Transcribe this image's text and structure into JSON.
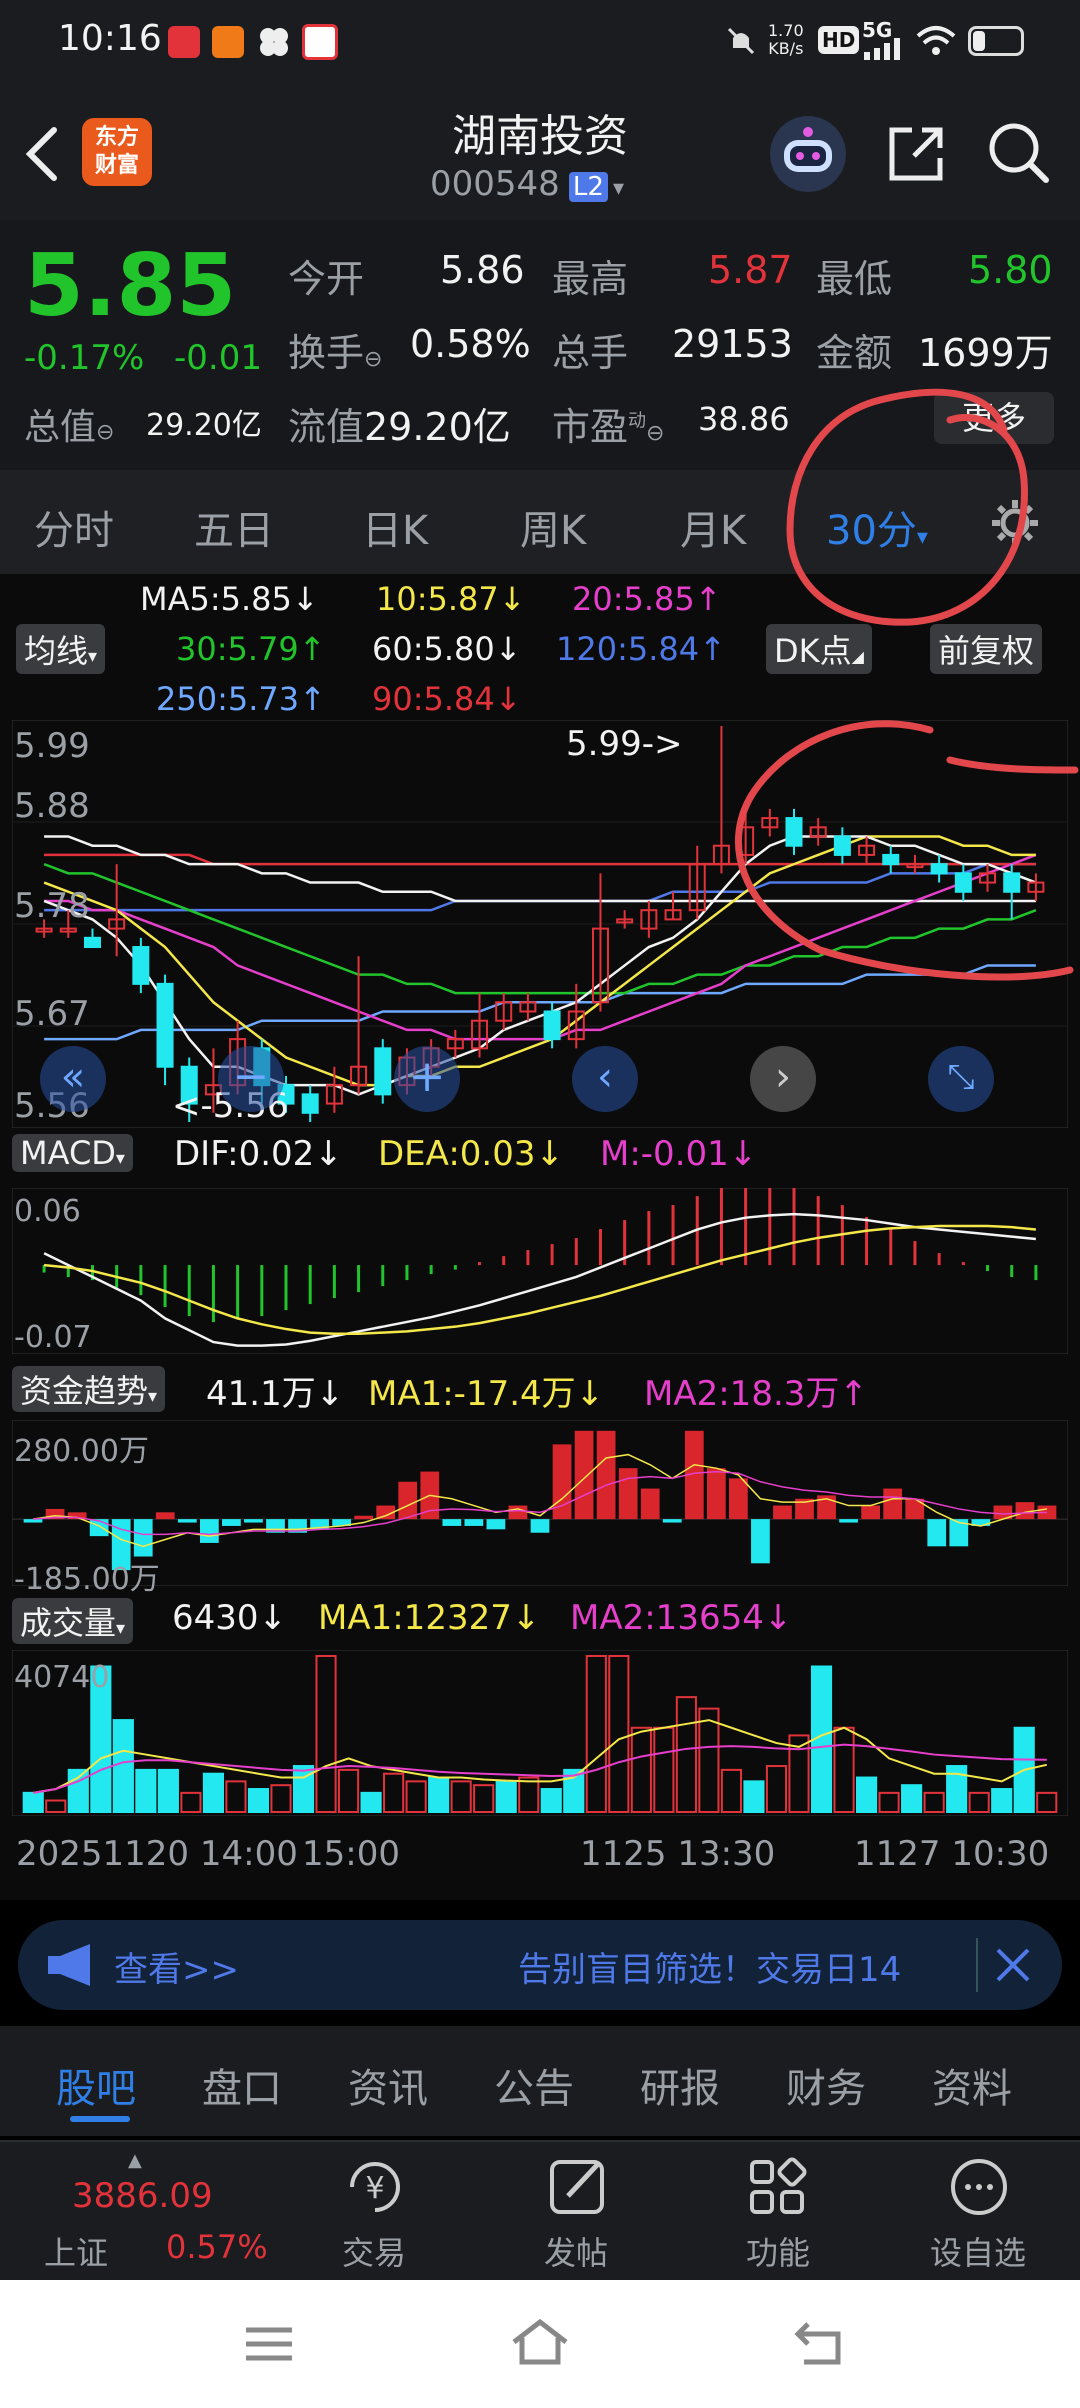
{
  "status_bar": {
    "time": "10:16",
    "net_speed_value": "1.70",
    "net_speed_unit": "KB/s",
    "hd": "HD",
    "signal": "5G",
    "battery_level": 0.25
  },
  "header": {
    "logo_line1": "东方",
    "logo_line2": "财富",
    "stock_name": "湖南投资",
    "stock_code": "000548",
    "level_badge": "L2"
  },
  "quote": {
    "price": "5.85",
    "change_pct": "-0.17%",
    "change": "-0.01",
    "open_label": "今开",
    "open": "5.86",
    "high_label": "最高",
    "high": "5.87",
    "low_label": "最低",
    "low": "5.80",
    "turnover_label": "换手",
    "turnover": "0.58%",
    "volume_label": "总手",
    "volume": "29153",
    "amount_label": "金额",
    "amount": "1699万",
    "mktcap_label": "总值",
    "mktcap": "29.20亿",
    "float_label": "流值",
    "float": "29.20亿",
    "pe_label": "市盈",
    "pe_sup": "动",
    "pe": "38.86",
    "more_label": "更多"
  },
  "tabs": [
    "分时",
    "五日",
    "日K",
    "周K",
    "月K",
    "30分"
  ],
  "chart": {
    "ma_button": "均线",
    "ma_legend": [
      {
        "text": "MA5:5.85↓",
        "color": "#f2f2f2"
      },
      {
        "text": "10:5.87↓",
        "color": "#f4e74a"
      },
      {
        "text": "20:5.85↑",
        "color": "#e53fcb"
      },
      {
        "text": "30:5.79↑",
        "color": "#21c42b"
      },
      {
        "text": "60:5.80↓",
        "color": "#f2f2f2"
      },
      {
        "text": "120:5.84↑",
        "color": "#4f79e8"
      },
      {
        "text": "250:5.73↑",
        "color": "#6fa8ff"
      },
      {
        "text": "90:5.84↓",
        "color": "#e2333b"
      }
    ],
    "dk_button": "DK点",
    "fq_button": "前复权",
    "y_labels": [
      "5.99",
      "5.88",
      "5.78",
      "5.67",
      "5.56"
    ],
    "high_marker": "5.99->",
    "low_marker": "<-5.56",
    "macd": {
      "title": "MACD",
      "dif": "DIF:0.02↓",
      "dea": "DEA:0.03↓",
      "m": "M:-0.01↓",
      "ytop": "0.06",
      "ybot": "-0.07"
    },
    "fund": {
      "title": "资金趋势",
      "value": "41.1万↓",
      "ma1": "MA1:-17.4万↓",
      "ma2": "MA2:18.3万↑",
      "ytop": "280.00万",
      "ybot": "-185.00万"
    },
    "vol": {
      "title": "成交量",
      "value": "6430↓",
      "ma1": "MA1:12327↓",
      "ma2": "MA2:13654↓",
      "ytop": "40740"
    },
    "x_labels": [
      "20251120 14:00",
      "15:00",
      "1125 13:30",
      "1127 10:30"
    ]
  },
  "chart_data": {
    "type": "candlestick",
    "ylim": [
      5.56,
      5.99
    ],
    "candles": [
      [
        5.77,
        5.77,
        5.78,
        5.76
      ],
      [
        5.77,
        5.77,
        5.79,
        5.76
      ],
      [
        5.76,
        5.75,
        5.77,
        5.75
      ],
      [
        5.77,
        5.78,
        5.84,
        5.74
      ],
      [
        5.75,
        5.71,
        5.76,
        5.7
      ],
      [
        5.71,
        5.62,
        5.72,
        5.6
      ],
      [
        5.62,
        5.58,
        5.63,
        5.56
      ],
      [
        5.59,
        5.6,
        5.64,
        5.57
      ],
      [
        5.6,
        5.65,
        5.67,
        5.59
      ],
      [
        5.64,
        5.6,
        5.65,
        5.58
      ],
      [
        5.6,
        5.58,
        5.61,
        5.57
      ],
      [
        5.59,
        5.57,
        5.6,
        5.56
      ],
      [
        5.58,
        5.6,
        5.62,
        5.57
      ],
      [
        5.6,
        5.62,
        5.74,
        5.59
      ],
      [
        5.64,
        5.59,
        5.65,
        5.58
      ],
      [
        5.6,
        5.63,
        5.64,
        5.59
      ],
      [
        5.62,
        5.64,
        5.65,
        5.61
      ],
      [
        5.64,
        5.65,
        5.66,
        5.63
      ],
      [
        5.64,
        5.67,
        5.7,
        5.63
      ],
      [
        5.67,
        5.69,
        5.7,
        5.66
      ],
      [
        5.68,
        5.69,
        5.7,
        5.67
      ],
      [
        5.68,
        5.65,
        5.69,
        5.64
      ],
      [
        5.65,
        5.68,
        5.71,
        5.64
      ],
      [
        5.69,
        5.77,
        5.83,
        5.68
      ],
      [
        5.78,
        5.78,
        5.79,
        5.77
      ],
      [
        5.77,
        5.79,
        5.8,
        5.76
      ],
      [
        5.78,
        5.79,
        5.81,
        5.78
      ],
      [
        5.79,
        5.84,
        5.86,
        5.78
      ],
      [
        5.84,
        5.86,
        5.99,
        5.83
      ],
      [
        5.85,
        5.88,
        5.9,
        5.84
      ],
      [
        5.88,
        5.89,
        5.9,
        5.87
      ],
      [
        5.89,
        5.86,
        5.9,
        5.85
      ],
      [
        5.87,
        5.88,
        5.89,
        5.86
      ],
      [
        5.87,
        5.85,
        5.88,
        5.84
      ],
      [
        5.85,
        5.86,
        5.87,
        5.84
      ],
      [
        5.85,
        5.84,
        5.86,
        5.83
      ],
      [
        5.84,
        5.84,
        5.85,
        5.83
      ],
      [
        5.84,
        5.83,
        5.85,
        5.82
      ],
      [
        5.83,
        5.81,
        5.84,
        5.8
      ],
      [
        5.82,
        5.83,
        5.84,
        5.81
      ],
      [
        5.83,
        5.81,
        5.84,
        5.78
      ],
      [
        5.81,
        5.82,
        5.83,
        5.8
      ]
    ],
    "ma5": [
      5.8,
      5.79,
      5.78,
      5.76,
      5.73,
      5.69,
      5.65,
      5.62,
      5.62,
      5.61,
      5.6,
      5.6,
      5.6,
      5.59,
      5.6,
      5.61,
      5.62,
      5.63,
      5.64,
      5.66,
      5.67,
      5.68,
      5.69,
      5.71,
      5.73,
      5.75,
      5.76,
      5.78,
      5.81,
      5.84,
      5.86,
      5.87,
      5.87,
      5.87,
      5.87,
      5.86,
      5.86,
      5.85,
      5.84,
      5.84,
      5.83,
      5.82
    ],
    "ma10": [
      5.82,
      5.81,
      5.8,
      5.79,
      5.77,
      5.75,
      5.72,
      5.69,
      5.67,
      5.65,
      5.63,
      5.62,
      5.61,
      5.6,
      5.6,
      5.61,
      5.61,
      5.62,
      5.62,
      5.63,
      5.64,
      5.65,
      5.67,
      5.69,
      5.71,
      5.73,
      5.75,
      5.77,
      5.79,
      5.81,
      5.83,
      5.84,
      5.85,
      5.86,
      5.87,
      5.87,
      5.87,
      5.87,
      5.86,
      5.86,
      5.85,
      5.85
    ],
    "ma20": [
      5.8,
      5.8,
      5.79,
      5.79,
      5.78,
      5.77,
      5.76,
      5.75,
      5.73,
      5.72,
      5.71,
      5.7,
      5.69,
      5.68,
      5.67,
      5.66,
      5.66,
      5.65,
      5.65,
      5.65,
      5.65,
      5.65,
      5.66,
      5.66,
      5.67,
      5.68,
      5.69,
      5.7,
      5.71,
      5.73,
      5.74,
      5.75,
      5.76,
      5.77,
      5.78,
      5.79,
      5.8,
      5.81,
      5.82,
      5.83,
      5.84,
      5.85
    ],
    "ma30": [
      5.84,
      5.83,
      5.83,
      5.82,
      5.81,
      5.8,
      5.79,
      5.78,
      5.77,
      5.76,
      5.75,
      5.74,
      5.73,
      5.72,
      5.72,
      5.71,
      5.71,
      5.7,
      5.7,
      5.7,
      5.7,
      5.7,
      5.7,
      5.7,
      5.7,
      5.71,
      5.71,
      5.72,
      5.72,
      5.73,
      5.73,
      5.74,
      5.74,
      5.75,
      5.75,
      5.76,
      5.76,
      5.77,
      5.77,
      5.78,
      5.78,
      5.79
    ],
    "ma60": [
      5.87,
      5.87,
      5.86,
      5.86,
      5.85,
      5.85,
      5.84,
      5.84,
      5.84,
      5.83,
      5.83,
      5.82,
      5.82,
      5.82,
      5.81,
      5.81,
      5.81,
      5.8,
      5.8,
      5.8,
      5.8,
      5.8,
      5.8,
      5.8,
      5.8,
      5.8,
      5.8,
      5.8,
      5.8,
      5.8,
      5.8,
      5.8,
      5.8,
      5.8,
      5.8,
      5.8,
      5.8,
      5.8,
      5.8,
      5.8,
      5.8,
      5.8
    ],
    "ma90": [
      5.85,
      5.85,
      5.85,
      5.85,
      5.85,
      5.85,
      5.85,
      5.84,
      5.84,
      5.84,
      5.84,
      5.84,
      5.84,
      5.84,
      5.84,
      5.84,
      5.84,
      5.84,
      5.84,
      5.84,
      5.84,
      5.84,
      5.84,
      5.84,
      5.84,
      5.84,
      5.84,
      5.84,
      5.84,
      5.84,
      5.84,
      5.84,
      5.84,
      5.84,
      5.84,
      5.84,
      5.84,
      5.84,
      5.84,
      5.84,
      5.84,
      5.84
    ],
    "ma120": [
      5.79,
      5.79,
      5.79,
      5.79,
      5.79,
      5.79,
      5.79,
      5.79,
      5.79,
      5.79,
      5.79,
      5.79,
      5.79,
      5.79,
      5.79,
      5.79,
      5.79,
      5.8,
      5.8,
      5.8,
      5.8,
      5.8,
      5.8,
      5.8,
      5.8,
      5.8,
      5.81,
      5.81,
      5.81,
      5.81,
      5.82,
      5.82,
      5.82,
      5.82,
      5.82,
      5.83,
      5.83,
      5.83,
      5.83,
      5.84,
      5.84,
      5.84
    ],
    "ma250": [
      5.65,
      5.65,
      5.65,
      5.65,
      5.66,
      5.66,
      5.66,
      5.66,
      5.66,
      5.67,
      5.67,
      5.67,
      5.67,
      5.67,
      5.68,
      5.68,
      5.68,
      5.68,
      5.68,
      5.69,
      5.69,
      5.69,
      5.69,
      5.69,
      5.7,
      5.7,
      5.7,
      5.7,
      5.7,
      5.71,
      5.71,
      5.71,
      5.71,
      5.71,
      5.72,
      5.72,
      5.72,
      5.72,
      5.72,
      5.73,
      5.73,
      5.73
    ],
    "macd_hist": [
      -0.005,
      -0.008,
      -0.01,
      -0.015,
      -0.02,
      -0.028,
      -0.034,
      -0.038,
      -0.036,
      -0.034,
      -0.03,
      -0.026,
      -0.022,
      -0.018,
      -0.014,
      -0.01,
      -0.006,
      -0.003,
      0.002,
      0.006,
      0.01,
      0.014,
      0.018,
      0.024,
      0.03,
      0.036,
      0.04,
      0.046,
      0.052,
      0.056,
      0.056,
      0.052,
      0.046,
      0.04,
      0.032,
      0.024,
      0.016,
      0.008,
      0.002,
      -0.004,
      -0.008,
      -0.01
    ],
    "dif": [
      0.01,
      0.0,
      -0.01,
      -0.02,
      -0.03,
      -0.045,
      -0.055,
      -0.065,
      -0.068,
      -0.068,
      -0.067,
      -0.064,
      -0.06,
      -0.056,
      -0.052,
      -0.048,
      -0.044,
      -0.039,
      -0.034,
      -0.028,
      -0.022,
      -0.016,
      -0.01,
      -0.002,
      0.006,
      0.014,
      0.022,
      0.03,
      0.036,
      0.04,
      0.042,
      0.043,
      0.042,
      0.04,
      0.038,
      0.035,
      0.032,
      0.03,
      0.028,
      0.026,
      0.024,
      0.022
    ],
    "dea": [
      0.0,
      -0.002,
      -0.005,
      -0.01,
      -0.015,
      -0.022,
      -0.03,
      -0.038,
      -0.045,
      -0.05,
      -0.054,
      -0.057,
      -0.058,
      -0.058,
      -0.057,
      -0.056,
      -0.054,
      -0.052,
      -0.049,
      -0.045,
      -0.041,
      -0.036,
      -0.031,
      -0.026,
      -0.02,
      -0.014,
      -0.008,
      -0.002,
      0.004,
      0.009,
      0.014,
      0.019,
      0.023,
      0.026,
      0.029,
      0.031,
      0.032,
      0.033,
      0.033,
      0.033,
      0.032,
      0.03
    ],
    "fund_bars": [
      -10,
      30,
      20,
      -50,
      -150,
      -110,
      20,
      -10,
      -70,
      -20,
      -10,
      -40,
      -40,
      -30,
      -20,
      10,
      40,
      110,
      140,
      -20,
      -20,
      -30,
      40,
      -40,
      220,
      260,
      260,
      150,
      90,
      -10,
      260,
      150,
      120,
      -130,
      40,
      60,
      70,
      -10,
      40,
      90,
      60,
      -80,
      -80,
      -20,
      40,
      50,
      40
    ],
    "fund_ma1": [
      0,
      10,
      5,
      -20,
      -60,
      -80,
      -60,
      -40,
      -50,
      -40,
      -30,
      -30,
      -30,
      -25,
      -20,
      -10,
      10,
      40,
      70,
      60,
      40,
      20,
      30,
      10,
      60,
      120,
      180,
      190,
      160,
      120,
      160,
      150,
      130,
      60,
      50,
      50,
      60,
      40,
      40,
      60,
      60,
      20,
      -10,
      -20,
      0,
      20,
      30
    ],
    "fund_ma2": [
      0,
      5,
      5,
      -5,
      -30,
      -45,
      -45,
      -40,
      -45,
      -40,
      -35,
      -35,
      -35,
      -30,
      -28,
      -22,
      -12,
      5,
      25,
      30,
      28,
      22,
      25,
      20,
      40,
      70,
      100,
      120,
      125,
      120,
      135,
      140,
      135,
      110,
      95,
      85,
      80,
      70,
      65,
      65,
      60,
      45,
      30,
      20,
      15,
      18,
      20
    ],
    "vol_bars": [
      5000,
      3000,
      11000,
      38000,
      24000,
      11000,
      11000,
      5000,
      10000,
      8000,
      6000,
      7000,
      12000,
      40740,
      11000,
      5000,
      10000,
      8000,
      9000,
      8000,
      7000,
      8000,
      9000,
      6000,
      11000,
      40740,
      40740,
      22000,
      22000,
      30000,
      27000,
      11000,
      8000,
      12000,
      20000,
      38000,
      22000,
      9000,
      5000,
      7000,
      5000,
      12000,
      5000,
      6000,
      22000,
      5000
    ],
    "vol_ma1": [
      5000,
      6000,
      9000,
      14000,
      16000,
      15000,
      14000,
      13000,
      12000,
      11000,
      10000,
      9000,
      9000,
      12000,
      14000,
      12000,
      11000,
      10000,
      9000,
      9000,
      8500,
      8200,
      8000,
      8000,
      9000,
      14000,
      19000,
      21000,
      22000,
      23000,
      24000,
      22000,
      20000,
      18000,
      17000,
      20000,
      22000,
      19000,
      14000,
      12000,
      10000,
      10000,
      9000,
      8000,
      11000,
      12327
    ],
    "vol_ma2": [
      5000,
      6000,
      8000,
      11000,
      13000,
      13500,
      13500,
      13000,
      12500,
      12000,
      11500,
      11000,
      10800,
      11500,
      12000,
      11800,
      11500,
      11000,
      10500,
      10200,
      10000,
      9800,
      9600,
      9400,
      9500,
      11000,
      13000,
      14500,
      15500,
      16500,
      17000,
      17200,
      17000,
      16600,
      16400,
      17000,
      17600,
      17200,
      16500,
      15800,
      15000,
      14600,
      14200,
      13800,
      13700,
      13654
    ]
  },
  "toast": {
    "link": "查看>>",
    "message": "告别盲目筛选！交易日14"
  },
  "bottom_tabs": [
    "股吧",
    "盘口",
    "资讯",
    "公告",
    "研报",
    "财务",
    "资料"
  ],
  "bottom_nav": {
    "index_value": "3886.09",
    "index_name": "上证",
    "index_pct": "0.57%",
    "items": [
      "交易",
      "发帖",
      "功能",
      "设自选"
    ]
  },
  "colors": {
    "up": "#e2333b",
    "down": "#23e8f0",
    "accent": "#2f7fe6",
    "annotation": "#e1474b"
  }
}
